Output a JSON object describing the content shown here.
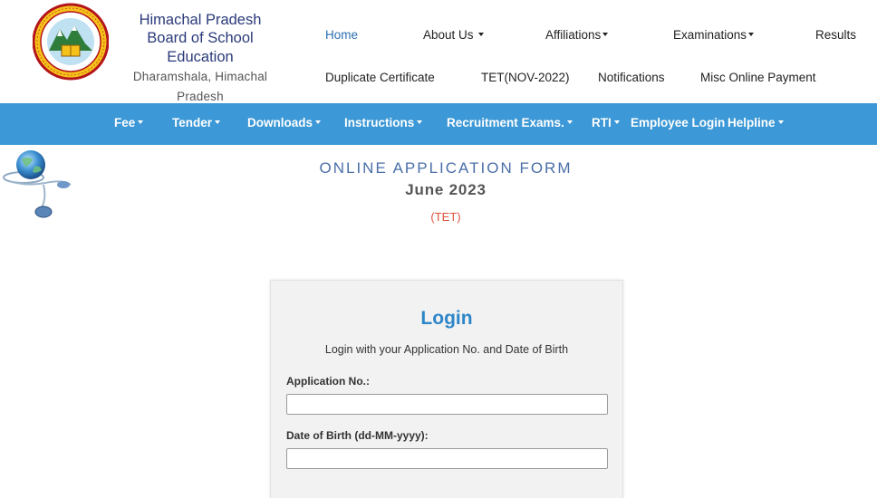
{
  "header": {
    "org_line1": "Himachal Pradesh",
    "org_line2": "Board of School Education",
    "org_line3": "Dharamshala, Himachal Pradesh",
    "logo_icon": "hpbose-emblem-icon"
  },
  "topnav": {
    "row1": [
      {
        "label": "Home",
        "dropdown": false
      },
      {
        "label": "About Us",
        "dropdown": true
      },
      {
        "label": "Affiliations",
        "dropdown": true
      },
      {
        "label": "Examinations",
        "dropdown": true
      },
      {
        "label": "Results",
        "dropdown": false
      }
    ],
    "row2": [
      {
        "label": "Duplicate Certificate"
      },
      {
        "label": "TET(NOV-2022)"
      },
      {
        "label": "Notifications"
      },
      {
        "label": "Misc Online Payment"
      }
    ]
  },
  "mainnav": [
    {
      "label": "Fee",
      "dropdown": true
    },
    {
      "label": "Tender",
      "dropdown": true
    },
    {
      "label": "Downloads",
      "dropdown": true
    },
    {
      "label": "Instructions",
      "dropdown": true
    },
    {
      "label": "Recruitment Exams.",
      "dropdown": true
    },
    {
      "label": "RTI",
      "dropdown": true
    },
    {
      "label": "Employee Login",
      "dropdown": false
    },
    {
      "label": "Helpline",
      "dropdown": true
    }
  ],
  "page": {
    "title": "ONLINE APPLICATION FORM",
    "session": "June 2023",
    "exam_tag": "(TET)",
    "globe_icon": "globe-mouse-icon"
  },
  "login": {
    "heading": "Login",
    "instruction": "Login with your Application No. and Date of Birth",
    "application_label": "Application No.:",
    "application_value": "",
    "dob_label": "Date of Birth (dd-MM-yyyy):",
    "dob_value": ""
  },
  "colors": {
    "nav_bar": "#3c98d6",
    "login_heading": "#2e86c8",
    "exam_tag": "#e0533a",
    "title": "#4a6fa8"
  }
}
